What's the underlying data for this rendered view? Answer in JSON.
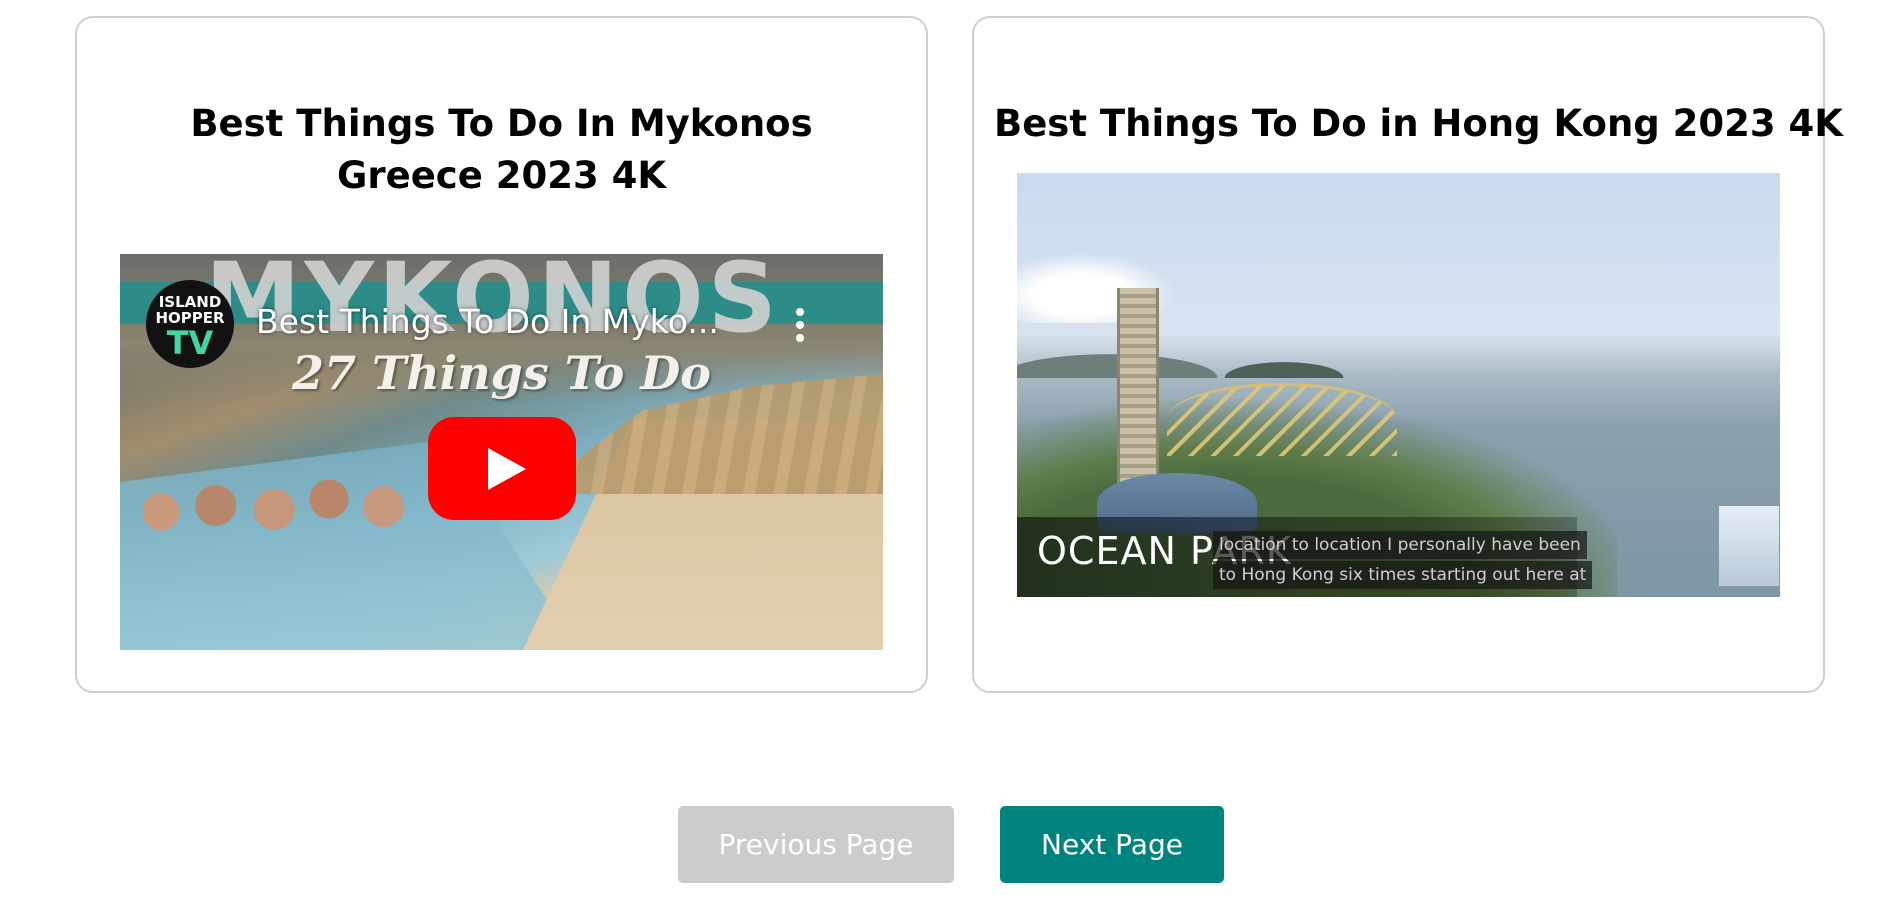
{
  "cards": [
    {
      "title": "Best Things To Do In Mykonos Greece 2023 4K",
      "video": {
        "channel_logo": {
          "line1": "ISLAND",
          "line2": "HOPPER",
          "line3": "TV"
        },
        "player_title": "Best Things To Do In Myko...",
        "thumbnail_headline": "MYKONOS",
        "thumbnail_subtitle": "27 Things To Do",
        "play_icon": "youtube-play-icon",
        "more_icon": "kebab-more-icon"
      }
    },
    {
      "title": "Best Things To Do in Hong Kong 2023 4K",
      "video": {
        "overlay_label": "OCEAN PARK",
        "captions": [
          "location to location I personally have been",
          "to Hong Kong six times starting out here at"
        ]
      }
    }
  ],
  "pagination": {
    "prev_label": "Previous Page",
    "next_label": "Next Page",
    "prev_color": "#cccccc",
    "next_color": "#00837f"
  }
}
